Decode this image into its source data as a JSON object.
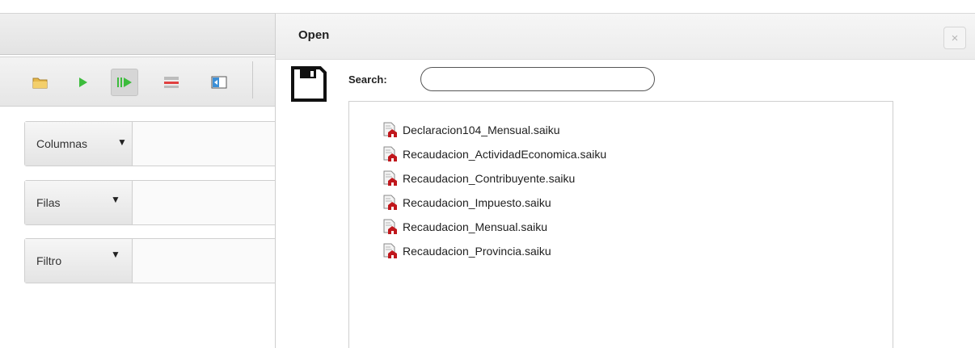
{
  "workspace": {
    "toolbar_icons": [
      "open-folder-icon",
      "run-icon",
      "automatic-run-icon",
      "toggle-fields-icon",
      "toggle-sidebar-icon"
    ],
    "drop_zones": [
      {
        "label": "Columnas"
      },
      {
        "label": "Filas"
      },
      {
        "label": "Filtro"
      }
    ]
  },
  "dialog": {
    "title": "Open",
    "close_label": "×",
    "search": {
      "label": "Search:",
      "value": ""
    },
    "files": [
      {
        "name": "Declaracion104_Mensual.saiku"
      },
      {
        "name": "Recaudacion_ActividadEconomica.saiku"
      },
      {
        "name": "Recaudacion_Contribuyente.saiku"
      },
      {
        "name": "Recaudacion_Impuesto.saiku"
      },
      {
        "name": "Recaudacion_Mensual.saiku"
      },
      {
        "name": "Recaudacion_Provincia.saiku"
      }
    ]
  },
  "colors": {
    "file_icon_red": "#c0171c",
    "run_green": "#3cbc3c"
  }
}
